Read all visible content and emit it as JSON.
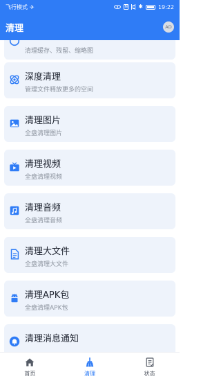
{
  "status": {
    "left_text": "飞行模式",
    "time": "19:22",
    "icons": [
      "airplane-icon",
      "eye-icon",
      "nfc-icon",
      "vibrate-icon",
      "bluetooth-icon",
      "battery-icon"
    ]
  },
  "header": {
    "title": "清理",
    "avatar_text": "AD"
  },
  "items": [
    {
      "title": "",
      "sub": "清理缓存、残留、缩略图",
      "icon": "cache-icon"
    },
    {
      "title": "深度清理",
      "sub": "管理文件释放更多的空间",
      "icon": "deep-clean-icon"
    },
    {
      "title": "清理图片",
      "sub": "全盘清理图片",
      "icon": "image-icon"
    },
    {
      "title": "清理视频",
      "sub": "全盘清理视频",
      "icon": "video-icon"
    },
    {
      "title": "清理音频",
      "sub": "全盘清理音频",
      "icon": "music-icon"
    },
    {
      "title": "清理大文件",
      "sub": "全盘清理大文件",
      "icon": "document-icon"
    },
    {
      "title": "清理APK包",
      "sub": "全盘清理APK包",
      "icon": "android-icon"
    },
    {
      "title": "清理消息通知",
      "sub": "",
      "icon": "bell-icon"
    }
  ],
  "nav": [
    {
      "label": "首页",
      "icon": "home-icon"
    },
    {
      "label": "清理",
      "icon": "broom-icon"
    },
    {
      "label": "状态",
      "icon": "status-icon"
    }
  ],
  "colors": {
    "primary": "#2f7cf6",
    "card_bg": "#eef3fb",
    "title_text": "#1f2430",
    "sub_text": "#8c939e"
  }
}
